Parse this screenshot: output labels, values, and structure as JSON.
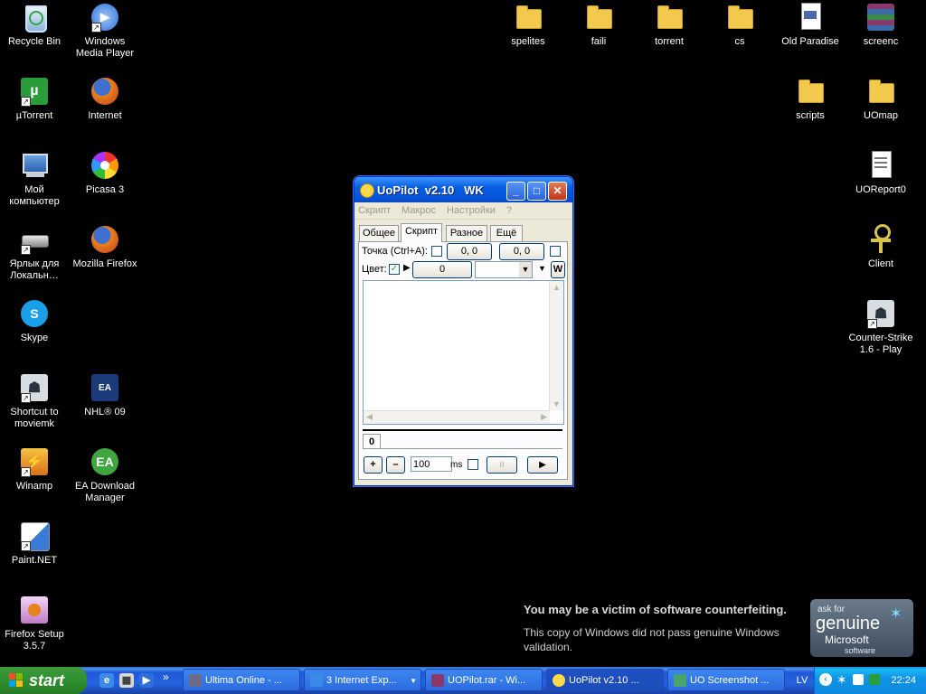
{
  "desktop_icons": [
    {
      "label": "Recycle Bin",
      "icon": "recycle-bin-icon",
      "color": "#7fb3e6"
    },
    {
      "label": "Windows Media Player",
      "icon": "media-player-icon",
      "color": "#2e6fd8"
    },
    {
      "label": "µTorrent",
      "icon": "utorrent-icon",
      "color": "#2a9c3a"
    },
    {
      "label": "Internet",
      "icon": "firefox-icon",
      "color": "#e87a1d"
    },
    {
      "label": "Мой компьютер",
      "icon": "my-computer-icon",
      "color": "#7aa7d8"
    },
    {
      "label": "Picasa 3",
      "icon": "picasa-icon",
      "color": "#d23f86"
    },
    {
      "label": "Ярлык для Локальн…",
      "icon": "drive-icon",
      "color": "#9a9a9a"
    },
    {
      "label": "Mozilla Firefox",
      "icon": "firefox-icon",
      "color": "#e87a1d"
    },
    {
      "label": "Skype",
      "icon": "skype-icon",
      "color": "#1aa0e8"
    },
    {
      "label": "Shortcut to moviemk",
      "icon": "counter-strike-icon",
      "color": "#4a5d6e"
    },
    {
      "label": "NHL® 09",
      "icon": "nhl-icon",
      "color": "#1b3a7a"
    },
    {
      "label": "Winamp",
      "icon": "winamp-icon",
      "color": "#e89a1d"
    },
    {
      "label": "EA Download Manager",
      "icon": "ea-icon",
      "color": "#3fa63f"
    },
    {
      "label": "Paint.NET",
      "icon": "paint-net-icon",
      "color": "#3a7bd8"
    },
    {
      "label": "Firefox Setup 3.5.7",
      "icon": "installer-icon",
      "color": "#c07ac8"
    },
    {
      "label": "spelites",
      "icon": "folder-icon"
    },
    {
      "label": "faili",
      "icon": "folder-icon"
    },
    {
      "label": "torrent",
      "icon": "folder-icon"
    },
    {
      "label": "cs",
      "icon": "folder-icon"
    },
    {
      "label": "Old Paradise",
      "icon": "text-document-icon"
    },
    {
      "label": "screenc",
      "icon": "winrar-icon",
      "color": "#8a3a6a"
    },
    {
      "label": "scripts",
      "icon": "folder-icon"
    },
    {
      "label": "UOmap",
      "icon": "folder-icon"
    },
    {
      "label": "UOReport0",
      "icon": "text-document-icon"
    },
    {
      "label": "Client",
      "icon": "ankh-icon",
      "color": "#d8c24a"
    },
    {
      "label": "Counter-Strike 1.6 - Play",
      "icon": "counter-strike-icon",
      "color": "#4a5d6e"
    }
  ],
  "uopilot": {
    "title": "UoPilot  v2.10   WK",
    "menu": [
      "Скрипт",
      "Макрос",
      "Настройки",
      "?"
    ],
    "tabs": [
      "Общее",
      "Скрипт",
      "Разное",
      "Ещё"
    ],
    "active_tab": "Скрипт",
    "point_label": "Точка (Ctrl+A):",
    "point_x": "0, 0",
    "point_y": "0, 0",
    "color_label": "Цвет:",
    "color_value": "0",
    "color_w": "W",
    "script_text": "",
    "line_tab": "0",
    "plus": "+",
    "minus": "–",
    "delay_value": "100",
    "delay_unit": "ms",
    "pause_symbol": "II",
    "play_symbol": "▶"
  },
  "genuine_notice": {
    "heading": "You may be a victim of software counterfeiting.",
    "body": "This copy of Windows did not pass genuine Windows validation.",
    "badge_top": "ask for",
    "badge_main": "genuine",
    "badge_brand": "Microsoft",
    "badge_sub": "software"
  },
  "taskbar": {
    "start_label": "start",
    "chevron": "»",
    "tasks": [
      {
        "label": "Ultima Online - ...",
        "color": "#6b6b8a"
      },
      {
        "label": "3 Internet Exp...",
        "color": "#3a8ae8"
      },
      {
        "label": "UOPilot.rar - Wi...",
        "color": "#8a3a6a"
      },
      {
        "label": "UoPilot  v2.10   ...",
        "color": "#ffd94a"
      },
      {
        "label": "UO Screenshot ...",
        "color": "#4aa36a"
      }
    ],
    "active_task": "UoPilot  v2.10   ...",
    "language": "LV",
    "clock": "22:24"
  }
}
